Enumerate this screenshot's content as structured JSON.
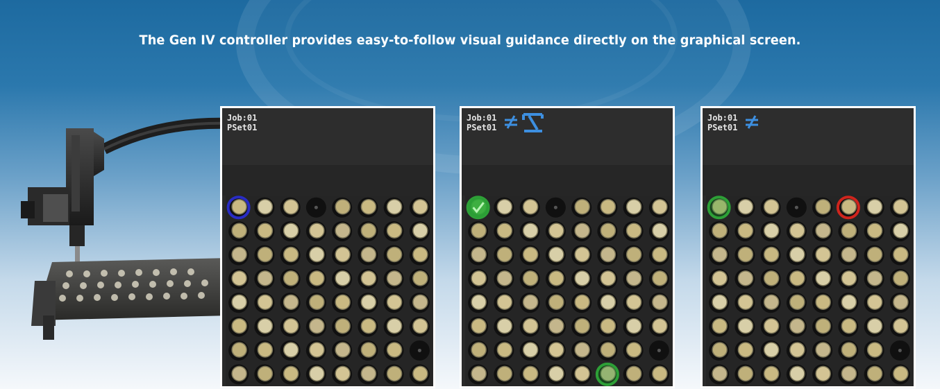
{
  "caption": "The Gen IV controller provides easy-to-follow visual guidance directly on the graphical screen.",
  "screens": [
    {
      "job": "Job:01",
      "pset": "PSet01",
      "icons": [],
      "markers": [
        {
          "row": 0,
          "col": 0,
          "color": "blue"
        }
      ]
    },
    {
      "job": "Job:01",
      "pset": "PSet01",
      "icons": [
        "not-equal-icon",
        "pick-arm-icon"
      ],
      "markers": [
        {
          "row": 0,
          "col": 0,
          "color": "green-filled"
        },
        {
          "row": 7,
          "col": 5,
          "color": "green"
        }
      ]
    },
    {
      "job": "Job:01",
      "pset": "PSet01",
      "icons": [
        "not-equal-icon"
      ],
      "markers": [
        {
          "row": 0,
          "col": 0,
          "color": "green"
        },
        {
          "row": 0,
          "col": 5,
          "color": "red"
        }
      ]
    }
  ],
  "grid": {
    "rows": 8,
    "cols": 8
  },
  "colors": {
    "blue": "#2a2dd6",
    "green": "#2fae3a",
    "red": "#e3261d",
    "accent_icon": "#3d8fe0"
  }
}
